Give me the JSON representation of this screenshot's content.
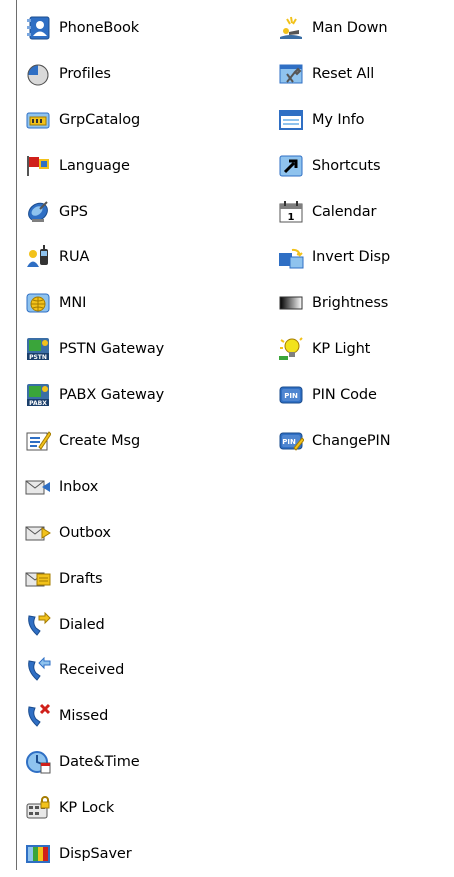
{
  "menu": {
    "column1": [
      {
        "label": "PhoneBook",
        "icon": "phonebook-icon",
        "slug": "phonebook"
      },
      {
        "label": "Profiles",
        "icon": "profiles-pie-icon",
        "slug": "profiles"
      },
      {
        "label": "GrpCatalog",
        "icon": "group-catalog-icon",
        "slug": "grpcatalog"
      },
      {
        "label": "Language",
        "icon": "language-flag-icon",
        "slug": "language"
      },
      {
        "label": "GPS",
        "icon": "satellite-dish-icon",
        "slug": "gps"
      },
      {
        "label": "RUA",
        "icon": "radio-user-icon",
        "slug": "rua"
      },
      {
        "label": "MNI",
        "icon": "network-globe-icon",
        "slug": "mni"
      },
      {
        "label": "PSTN Gateway",
        "icon": "pstn-gateway-icon",
        "slug": "pstn-gateway"
      },
      {
        "label": "PABX Gateway",
        "icon": "pabx-gateway-icon",
        "slug": "pabx-gateway"
      },
      {
        "label": "Create Msg",
        "icon": "create-message-icon",
        "slug": "create-msg"
      },
      {
        "label": "Inbox",
        "icon": "inbox-envelope-icon",
        "slug": "inbox"
      },
      {
        "label": "Outbox",
        "icon": "outbox-envelope-icon",
        "slug": "outbox"
      },
      {
        "label": "Drafts",
        "icon": "drafts-envelope-icon",
        "slug": "drafts"
      },
      {
        "label": "Dialed",
        "icon": "dialed-call-icon",
        "slug": "dialed"
      },
      {
        "label": "Received",
        "icon": "received-call-icon",
        "slug": "received"
      },
      {
        "label": "Missed",
        "icon": "missed-call-icon",
        "slug": "missed"
      },
      {
        "label": "Date&Time",
        "icon": "date-time-clock-icon",
        "slug": "date-time"
      },
      {
        "label": "KP Lock",
        "icon": "keypad-lock-icon",
        "slug": "kp-lock"
      },
      {
        "label": "DispSaver",
        "icon": "display-saver-icon",
        "slug": "dispsaver"
      }
    ],
    "column2": [
      {
        "label": "Man Down",
        "icon": "man-down-icon",
        "slug": "man-down"
      },
      {
        "label": "Reset All",
        "icon": "reset-tools-icon",
        "slug": "reset-all"
      },
      {
        "label": "My Info",
        "icon": "my-info-window-icon",
        "slug": "my-info"
      },
      {
        "label": "Shortcuts",
        "icon": "shortcut-arrow-icon",
        "slug": "shortcuts"
      },
      {
        "label": "Calendar",
        "icon": "calendar-icon",
        "slug": "calendar"
      },
      {
        "label": "Invert Disp",
        "icon": "invert-display-icon",
        "slug": "invert-disp"
      },
      {
        "label": "Brightness",
        "icon": "brightness-gradient-icon",
        "slug": "brightness"
      },
      {
        "label": "KP Light",
        "icon": "keypad-light-bulb-icon",
        "slug": "kp-light"
      },
      {
        "label": "PIN Code",
        "icon": "pin-code-icon",
        "slug": "pin-code"
      },
      {
        "label": "ChangePIN",
        "icon": "change-pin-icon",
        "slug": "changepin"
      }
    ]
  },
  "icon_text": {
    "pstn": "PSTN",
    "pabx": "PABX",
    "pin": "PIN",
    "calendar_day": "1"
  },
  "colors": {
    "text": "#000000",
    "divider": "#6e6e6e",
    "icon_blue": "#2f6fc4",
    "icon_light_blue": "#8fc3ee",
    "icon_yellow": "#f2c21b",
    "icon_red": "#d0201a",
    "icon_green": "#3aa53a"
  }
}
